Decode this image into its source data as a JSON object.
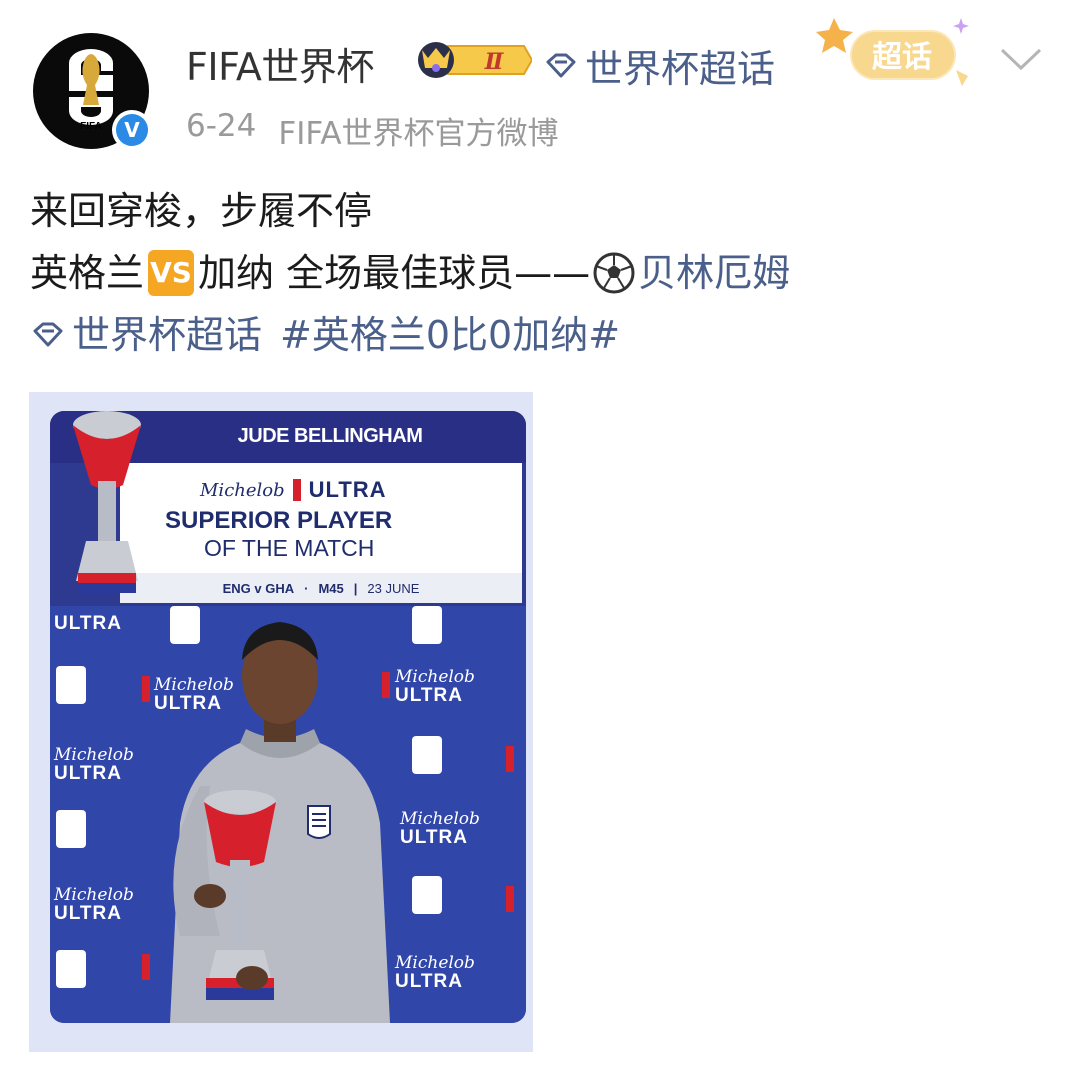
{
  "post": {
    "author": "FIFA世界杯",
    "rank_badge": "Ⅱ",
    "topic_link": "世界杯超话",
    "chaohua_badge": "超话",
    "date": "6-24",
    "source": "FIFA世界杯官方微博",
    "avatar_text": "FIFA",
    "verified_mark": "V",
    "text_line1": "来回穿梭，步履不停",
    "text_line2_a": "英格兰",
    "vs_badge": "VS",
    "text_line2_b": "加纳 全场最佳球员——",
    "text_line2_c": "贝林厄姆",
    "hashtag_topic": "世界杯超话",
    "hashtag": "#英格兰0比0加纳#"
  },
  "poster": {
    "player_name": "JUDE BELLINGHAM",
    "sponsor_script": "Michelob",
    "sponsor_word": "ULTRA",
    "title_line1": "SUPERIOR PLAYER",
    "title_line2": "OF THE MATCH",
    "fixture": "ENG v GHA",
    "match_no": "M45",
    "match_date": "23 JUNE",
    "backdrop_script": "Michelob",
    "backdrop_word": "ULTRA",
    "logo_text": "FIFA"
  },
  "colors": {
    "link": "#4a5f8a",
    "poster_blue": "#3146a9",
    "accent_red": "#d6202b",
    "vs_orange": "#f5a623",
    "verified_blue": "#2a8ae6"
  },
  "icons": [
    "fifa-logo-icon",
    "verified-icon",
    "rank-badge-icon",
    "diamond-topic-icon",
    "chaohua-icon",
    "chevron-down-icon",
    "vs-icon",
    "soccer-ball-icon",
    "trophy-icon"
  ]
}
